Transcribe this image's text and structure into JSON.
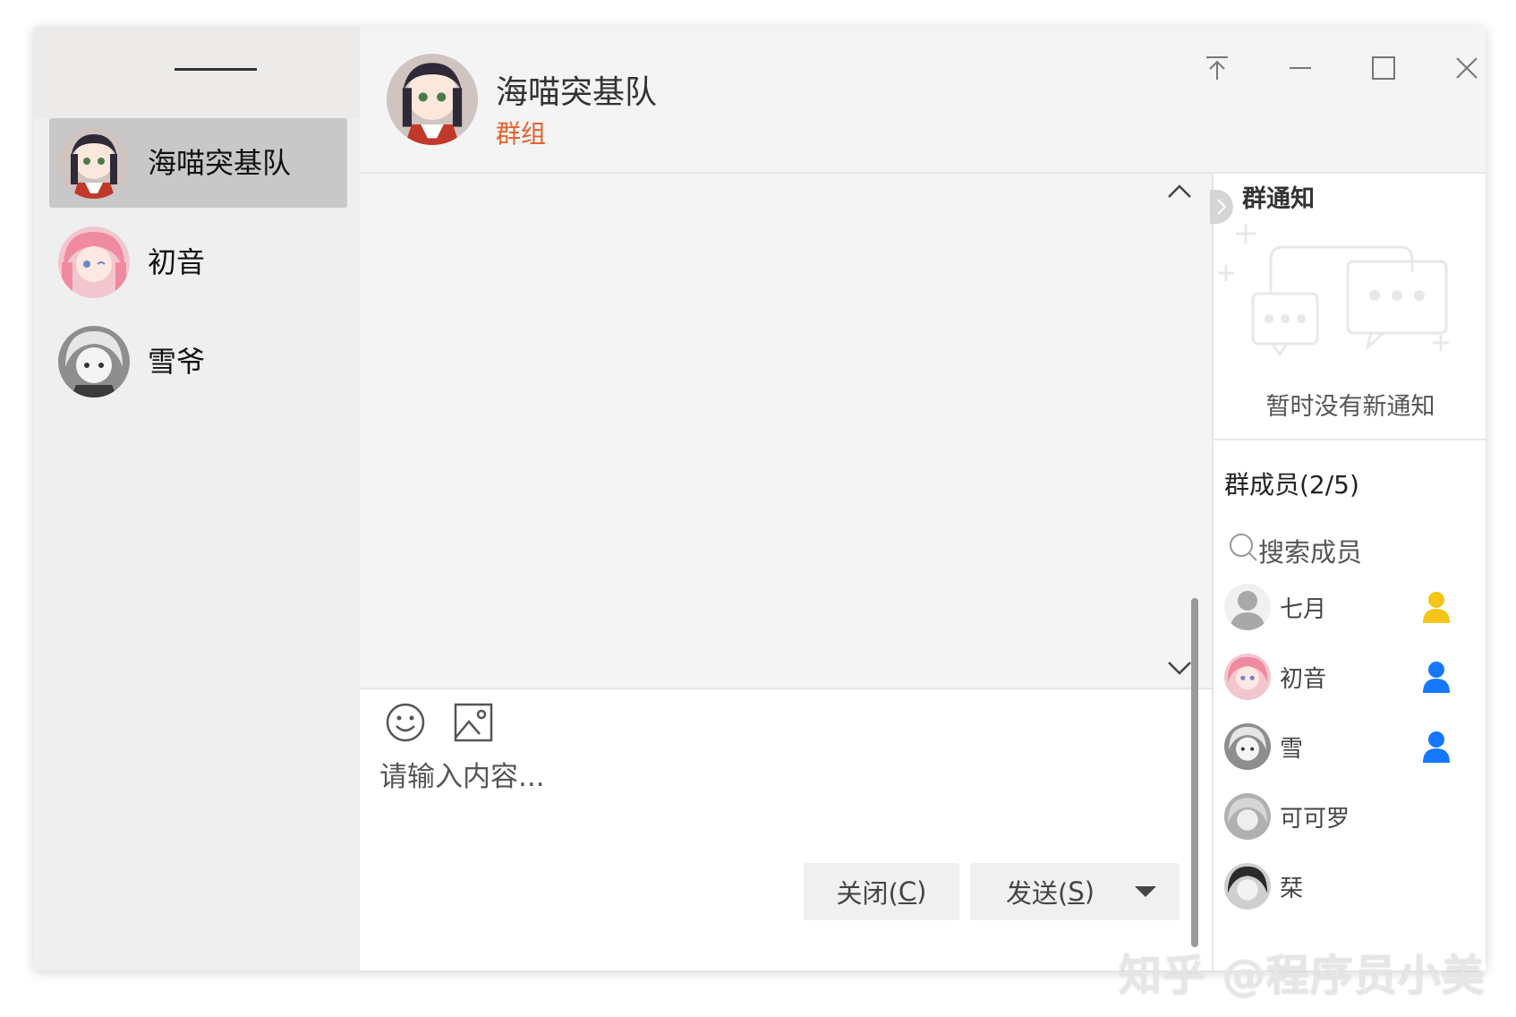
{
  "sidebar": {
    "contacts": [
      {
        "name": "海喵突基队",
        "active": true
      },
      {
        "name": "初音",
        "active": false
      },
      {
        "name": "雪爷",
        "active": false
      }
    ]
  },
  "chat": {
    "title": "海喵突基队",
    "subtitle": "群组"
  },
  "input": {
    "placeholder": "请输入内容...",
    "close_label_prefix": "关闭(",
    "close_label_key": "C",
    "close_label_suffix": ")",
    "send_label_prefix": "发送(",
    "send_label_key": "S",
    "send_label_suffix": ")"
  },
  "notice": {
    "title": "群通知",
    "empty_text": "暂时没有新通知"
  },
  "members": {
    "title": "群成员(2/5)",
    "search_placeholder": "搜索成员",
    "list": [
      {
        "name": "七月",
        "role": "owner",
        "role_color": "#f5c518"
      },
      {
        "name": "初音",
        "role": "member",
        "role_color": "#1677ff"
      },
      {
        "name": "雪",
        "role": "member",
        "role_color": "#1677ff"
      },
      {
        "name": "可可罗",
        "role": "",
        "role_color": ""
      },
      {
        "name": "栞",
        "role": "",
        "role_color": ""
      }
    ]
  },
  "colors": {
    "accent": "#e5622e",
    "owner": "#f5c518",
    "member": "#1677ff"
  },
  "watermark": "知乎 @程序员小美"
}
